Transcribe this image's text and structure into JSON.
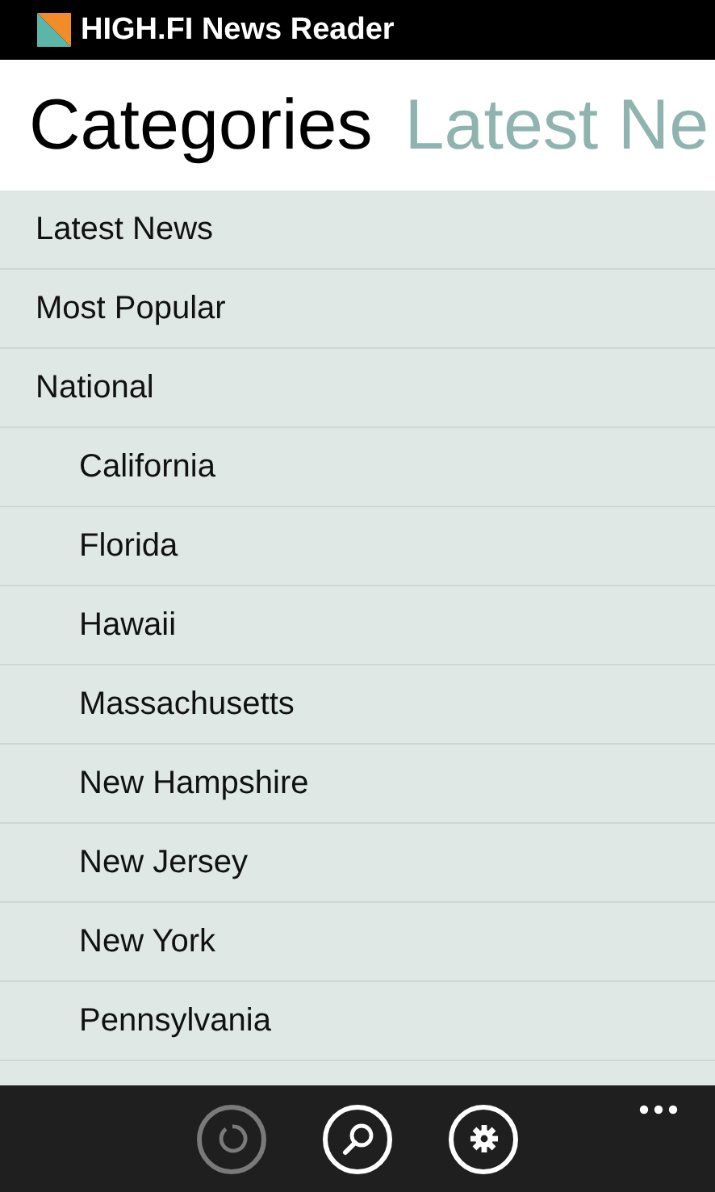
{
  "app_title": "HIGH.FI News Reader",
  "pivots": [
    {
      "label": "Categories",
      "selected": true
    },
    {
      "label": "Latest Ne",
      "selected": false
    }
  ],
  "categories": [
    {
      "label": "Latest News"
    },
    {
      "label": "Most Popular"
    },
    {
      "label": "National",
      "children": [
        {
          "label": "California"
        },
        {
          "label": "Florida"
        },
        {
          "label": "Hawaii"
        },
        {
          "label": "Massachusetts"
        },
        {
          "label": "New Hampshire"
        },
        {
          "label": "New Jersey"
        },
        {
          "label": "New York"
        },
        {
          "label": "Pennsylvania"
        }
      ]
    }
  ],
  "app_bar": {
    "buttons": [
      {
        "kind": "refresh",
        "disabled": true
      },
      {
        "kind": "search",
        "disabled": false
      },
      {
        "kind": "settings",
        "disabled": false
      }
    ]
  }
}
